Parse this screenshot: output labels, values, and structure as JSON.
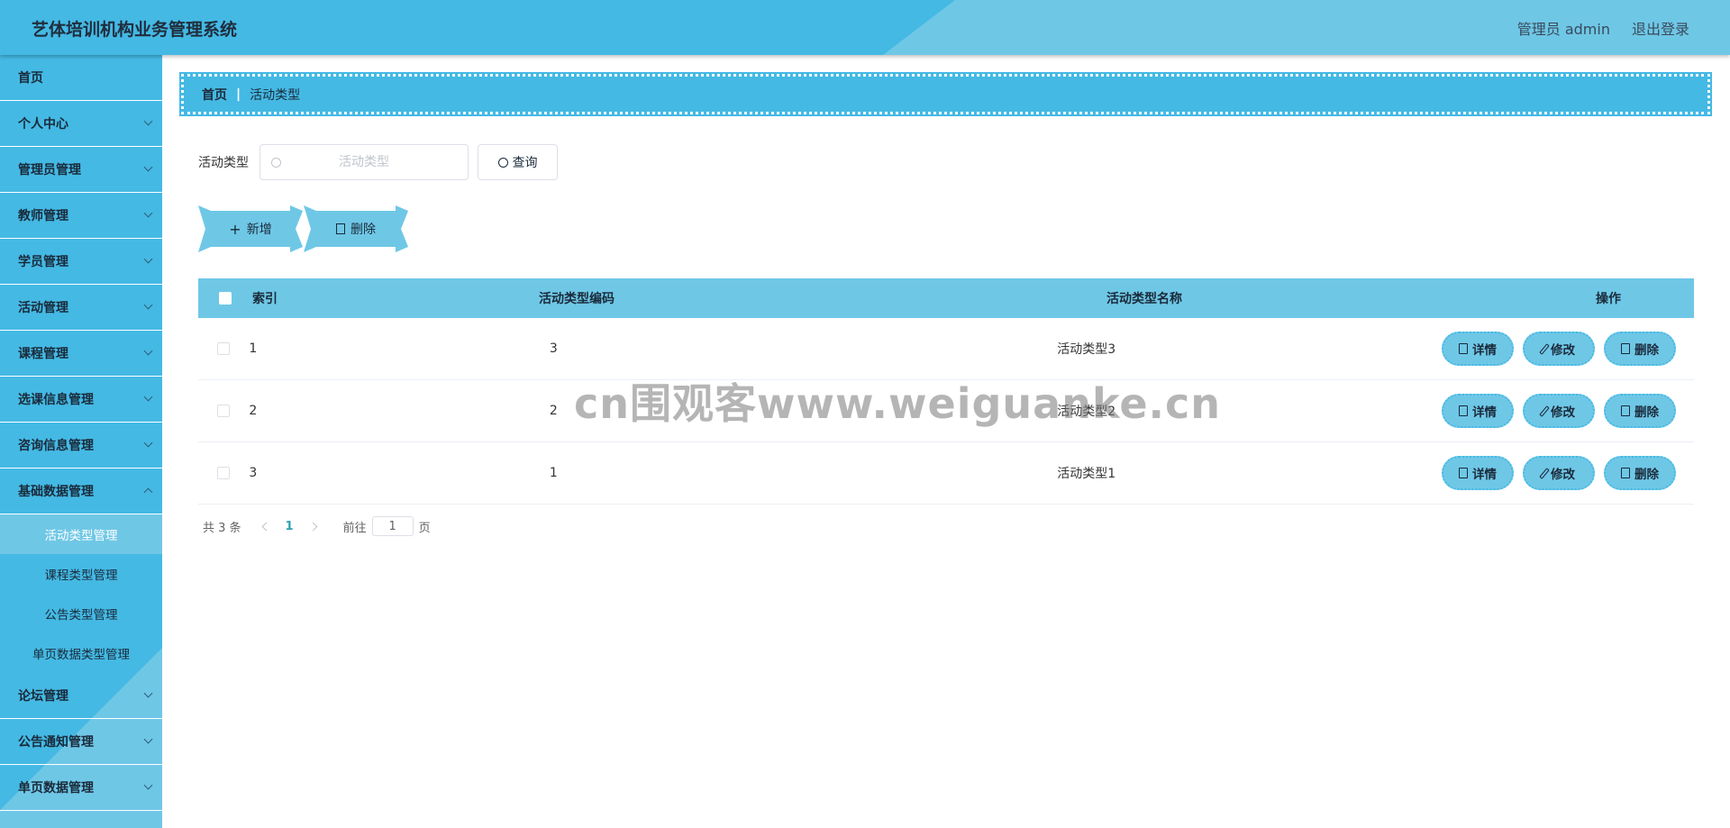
{
  "header": {
    "title": "艺体培训机构业务管理系统",
    "user": "管理员 admin",
    "logout": "退出登录"
  },
  "colors": {
    "primary": "#44b9e4",
    "light": "#6fc7e6",
    "active_page": "#2ea1b6"
  },
  "sidebar": {
    "items": [
      {
        "label": "首页",
        "has_children": false
      },
      {
        "label": "个人中心",
        "has_children": true
      },
      {
        "label": "管理员管理",
        "has_children": true
      },
      {
        "label": "教师管理",
        "has_children": true
      },
      {
        "label": "学员管理",
        "has_children": true
      },
      {
        "label": "活动管理",
        "has_children": true
      },
      {
        "label": "课程管理",
        "has_children": true
      },
      {
        "label": "选课信息管理",
        "has_children": true
      },
      {
        "label": "咨询信息管理",
        "has_children": true
      },
      {
        "label": "基础数据管理",
        "has_children": true,
        "open": true,
        "children": [
          "活动类型管理",
          "课程类型管理",
          "公告类型管理",
          "单页数据类型管理"
        ],
        "active_child": "活动类型管理"
      },
      {
        "label": "论坛管理",
        "has_children": true
      },
      {
        "label": "公告通知管理",
        "has_children": true
      },
      {
        "label": "单页数据管理",
        "has_children": true
      }
    ]
  },
  "breadcrumb": {
    "home": "首页",
    "separator": "|",
    "current": "活动类型"
  },
  "search": {
    "label": "活动类型",
    "placeholder": "活动类型",
    "value": "",
    "button": "查询"
  },
  "actions": {
    "add": "新增",
    "delete": "删除"
  },
  "table": {
    "columns": [
      "索引",
      "活动类型编码",
      "活动类型名称",
      "操作"
    ],
    "rows": [
      {
        "index": "1",
        "code": "3",
        "name": "活动类型3"
      },
      {
        "index": "2",
        "code": "2",
        "name": "活动类型2"
      },
      {
        "index": "3",
        "code": "1",
        "name": "活动类型1"
      }
    ],
    "row_actions": {
      "detail": "详情",
      "edit": "修改",
      "delete": "删除"
    }
  },
  "pagination": {
    "total": "共 3 条",
    "current_page": "1",
    "goto_label": "前往",
    "goto_value": "1",
    "page_suffix": "页"
  },
  "watermark": "cn围观客www.weiguanke.cn"
}
